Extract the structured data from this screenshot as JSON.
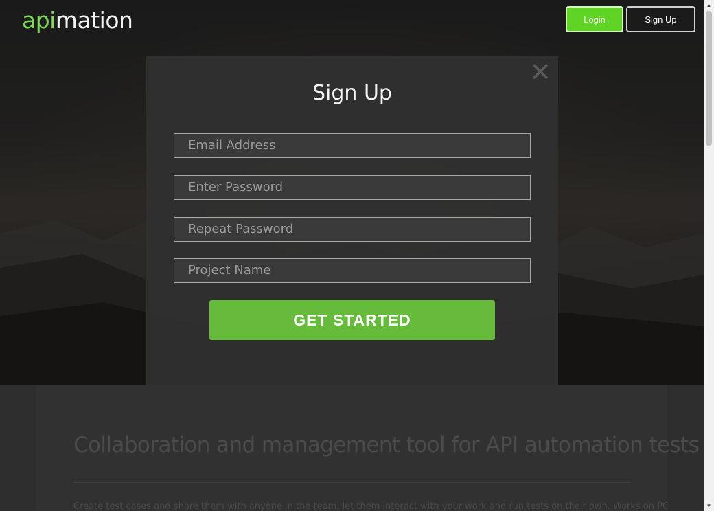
{
  "header": {
    "logo_part_a": "api",
    "logo_part_b": "mation",
    "login_label": "Login",
    "signup_label": "Sign Up"
  },
  "modal": {
    "close_icon": "close-icon",
    "title": "Sign Up",
    "fields": [
      {
        "placeholder": "Email Address"
      },
      {
        "placeholder": "Enter Password"
      },
      {
        "placeholder": "Repeat Password"
      },
      {
        "placeholder": "Project Name"
      }
    ],
    "submit_label": "GET STARTED"
  },
  "content": {
    "headline": "Collaboration and management tool for API automation tests",
    "description": "Create test cases and share them with anyone in the team, let them interact with your work and run tests on their own. Works on PC"
  },
  "colors": {
    "accent": "#5fd425",
    "start_button": "#66bb3a",
    "logo_accent": "#7ed957"
  }
}
